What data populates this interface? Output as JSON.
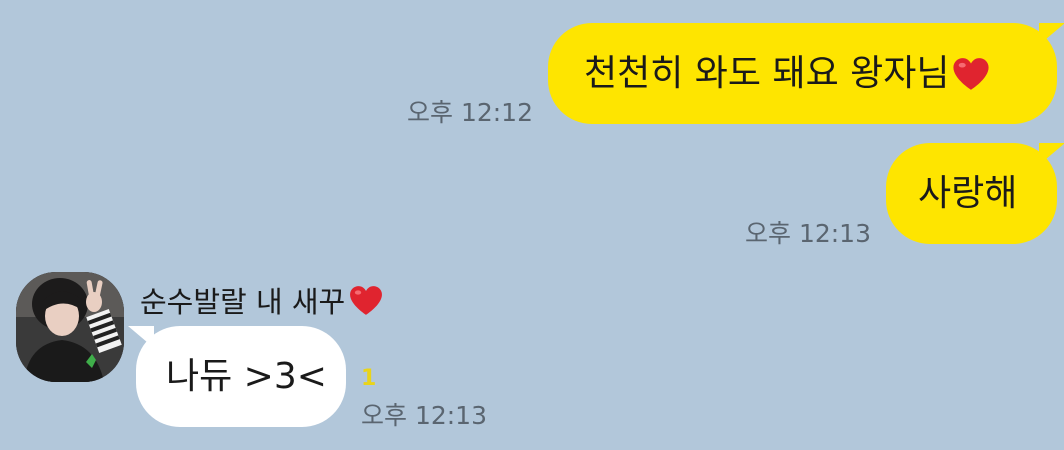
{
  "messages": {
    "m1": {
      "text": "천천히 와도 돼요 왕자님",
      "emoji": "heart-icon",
      "time": "오후 12:12"
    },
    "m2": {
      "text": "사랑해",
      "time": "오후 12:13"
    },
    "m3": {
      "sender": "순수발랄 내 새꾸",
      "sender_emoji": "heart-icon",
      "text": "나듀 >3<",
      "unread": "1",
      "time": "오후 12:13"
    }
  },
  "colors": {
    "background": "#b2c7da",
    "my_bubble": "#fee500",
    "other_bubble": "#ffffff",
    "heart": "#e0242f",
    "unread": "#e9d41a"
  }
}
